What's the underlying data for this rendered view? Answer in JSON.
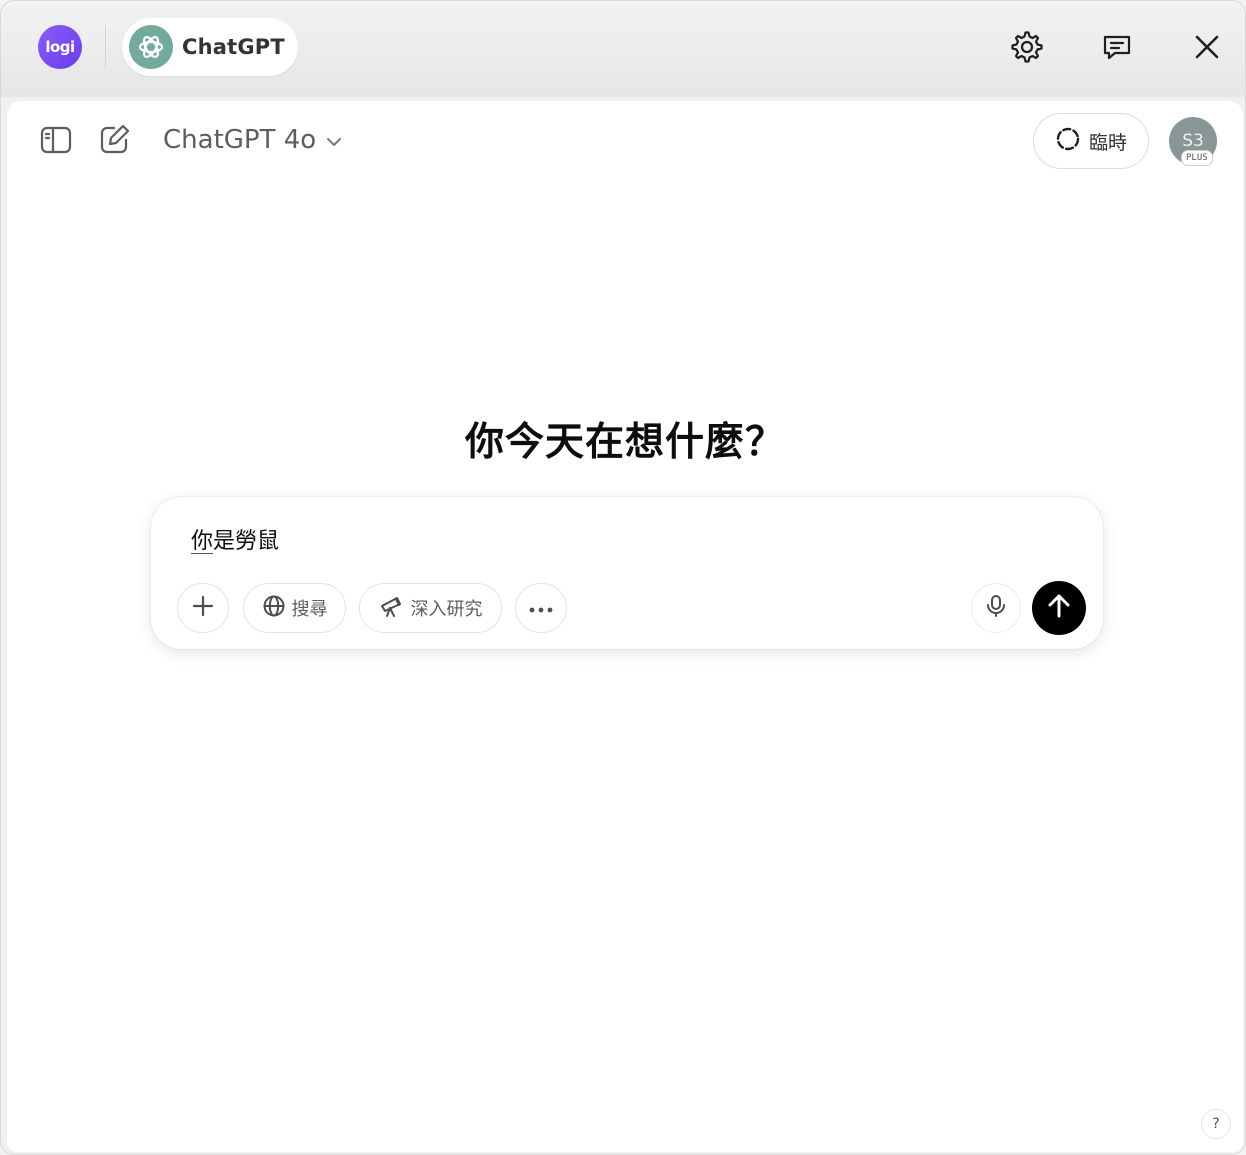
{
  "titlebar": {
    "logi_label": "logi",
    "app_name": "ChatGPT"
  },
  "header": {
    "model_name": "ChatGPT 4o",
    "temporary_label": "臨時",
    "avatar_initials": "S3",
    "plan_badge": "PLUS"
  },
  "main": {
    "headline": "你今天在想什麼？"
  },
  "composer": {
    "prompt_text": "你是勞鼠",
    "chips": [
      {
        "label": "搜尋",
        "icon": "globe-icon"
      },
      {
        "label": "深入研究",
        "icon": "telescope-icon"
      }
    ]
  },
  "footer": {
    "help_label": "?"
  },
  "colors": {
    "logi_purple": "#7b4ef4",
    "gpt_green": "#74aa9c",
    "send_button": "#000000",
    "avatar_bg": "#8a9597"
  }
}
